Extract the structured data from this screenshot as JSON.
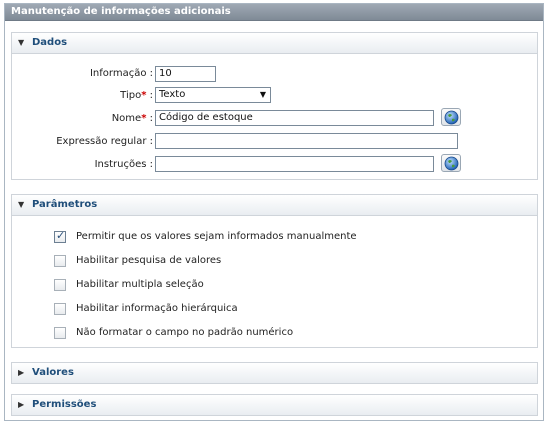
{
  "window": {
    "title": "Manutenção de informações adicionais"
  },
  "dados": {
    "header": "Dados",
    "informacao": {
      "label": "Informação :",
      "value": "10"
    },
    "tipo": {
      "label": "Tipo",
      "suffix": " :",
      "value": "Texto"
    },
    "nome": {
      "label": "Nome",
      "suffix": " :",
      "value": "Código de estoque"
    },
    "expressao": {
      "label": "Expressão regular :",
      "value": ""
    },
    "instrucoes": {
      "label": "Instruções :",
      "value": ""
    },
    "required_mark": "*"
  },
  "parametros": {
    "header": "Parâmetros",
    "options": [
      {
        "label": "Permitir que os valores sejam informados manualmente",
        "checked": true
      },
      {
        "label": "Habilitar pesquisa de valores",
        "checked": false
      },
      {
        "label": "Habilitar multipla seleção",
        "checked": false
      },
      {
        "label": "Habilitar informação hierárquica",
        "checked": false
      },
      {
        "label": "Não formatar o campo no padrão numérico",
        "checked": false
      }
    ]
  },
  "valores": {
    "header": "Valores"
  },
  "permissoes": {
    "header": "Permissões"
  },
  "colors": {
    "header_text": "#1f4e7a",
    "required": "#cc0000"
  },
  "icons": {
    "expanded": "triangle-down",
    "collapsed": "triangle-right",
    "lookup": "globe"
  }
}
